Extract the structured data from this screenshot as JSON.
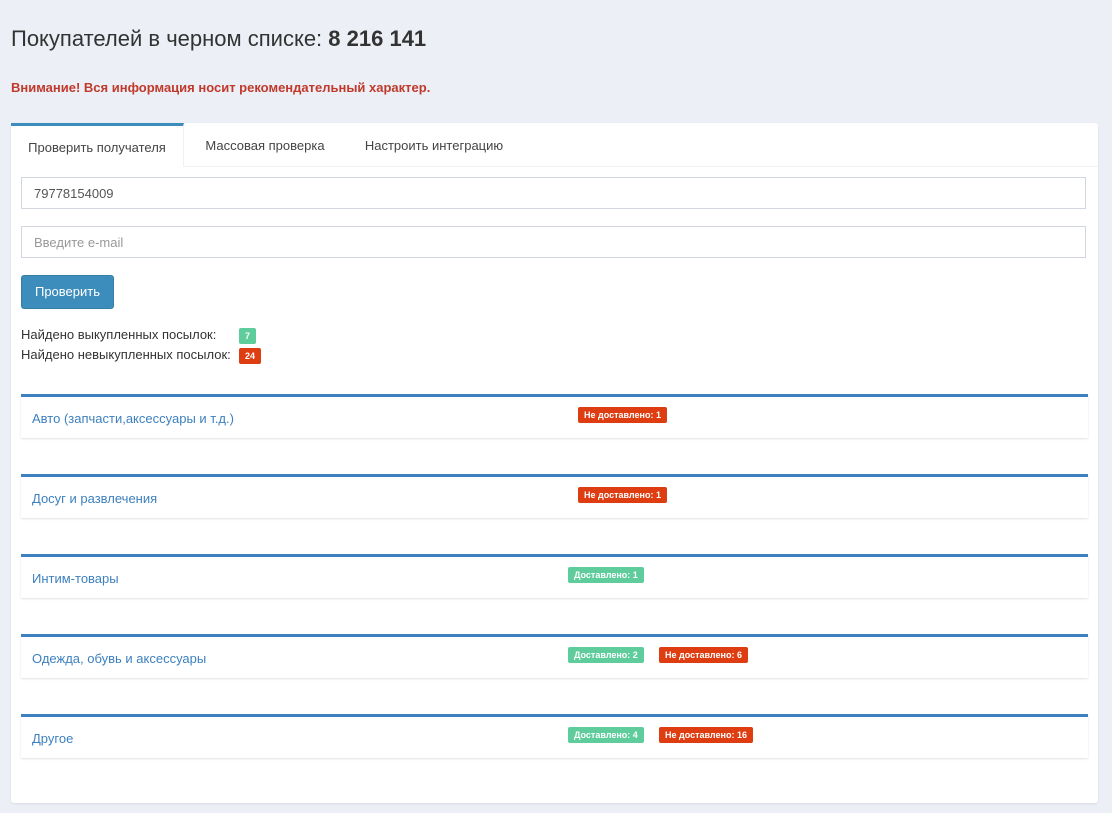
{
  "header": {
    "title_prefix": "Покупателей в черном списке:",
    "count": "8 216 141",
    "warning": "Внимание! Вся информация носит рекомендательный характер."
  },
  "tabs": [
    {
      "label": "Проверить получателя",
      "active": true
    },
    {
      "label": "Массовая проверка",
      "active": false
    },
    {
      "label": "Настроить интеграцию",
      "active": false
    }
  ],
  "form": {
    "phone_value": "79778154009",
    "email_placeholder": "Введите e-mail",
    "check_button": "Проверить"
  },
  "summary": {
    "bought_label": "Найдено выкупленных посылок:",
    "bought_count": "7",
    "not_bought_label": "Найдено невыкупленных посылок:",
    "not_bought_count": "24"
  },
  "categories": [
    {
      "name": "Авто (запчасти,аксессуары и т.д.)",
      "delivered": "",
      "not_delivered": "Не доставлено: 1"
    },
    {
      "name": "Досуг и развлечения",
      "delivered": "",
      "not_delivered": "Не доставлено: 1"
    },
    {
      "name": "Интим-товары",
      "delivered": "Доставлено: 1",
      "not_delivered": ""
    },
    {
      "name": "Одежда, обувь и аксессуары",
      "delivered": "Доставлено: 2",
      "not_delivered": "Не доставлено: 6"
    },
    {
      "name": "Другое",
      "delivered": "Доставлено: 4",
      "not_delivered": "Не доставлено: 16"
    }
  ],
  "colors": {
    "accent": "#3c8dbc",
    "delivered": "#5fcc9c",
    "not_delivered": "#de3d12",
    "warning": "#c0392b"
  }
}
